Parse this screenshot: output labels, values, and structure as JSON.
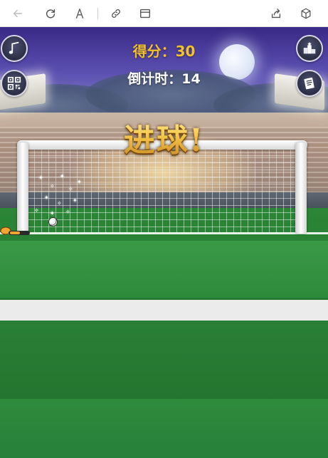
{
  "hud": {
    "score_label": "得分：",
    "score_value": "30",
    "timer_label": "倒计时：",
    "timer_value": "14"
  },
  "banner": {
    "text": "进球!"
  },
  "toolbar": {
    "icons": [
      "back-arrow-icon",
      "refresh-icon",
      "text-size-icon",
      "link-icon",
      "window-icon",
      "share-icon",
      "cube-icon"
    ]
  },
  "side_buttons": {
    "left": [
      "music-note-icon",
      "qr-code-icon"
    ],
    "right": [
      "leaderboard-podium-icon",
      "notepad-icon"
    ]
  },
  "colors": {
    "score": "#f3c22b",
    "timer": "#ffffff",
    "banner": "#f3c04b",
    "pitch": "#237a30",
    "sky": "#3a2a86"
  }
}
